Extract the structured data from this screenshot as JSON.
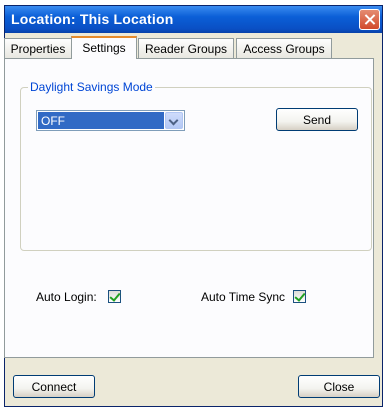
{
  "window": {
    "title": "Location: This Location"
  },
  "tabs": [
    {
      "label": "Properties",
      "active": false
    },
    {
      "label": "Settings",
      "active": true
    },
    {
      "label": "Reader Groups",
      "active": false
    },
    {
      "label": "Access Groups",
      "active": false
    }
  ],
  "daylight": {
    "group_label": "Daylight Savings Mode",
    "selected": "OFF",
    "send_label": "Send"
  },
  "options": {
    "auto_login_label": "Auto Login:",
    "auto_login_checked": true,
    "auto_time_sync_label": "Auto Time Sync",
    "auto_time_sync_checked": true
  },
  "footer": {
    "connect_label": "Connect",
    "close_label": "Close"
  },
  "colors": {
    "titlebar": "#0a4fc4",
    "active_tab_accent": "#e68b2c",
    "group_label": "#0046d5",
    "selection": "#316ac5"
  }
}
